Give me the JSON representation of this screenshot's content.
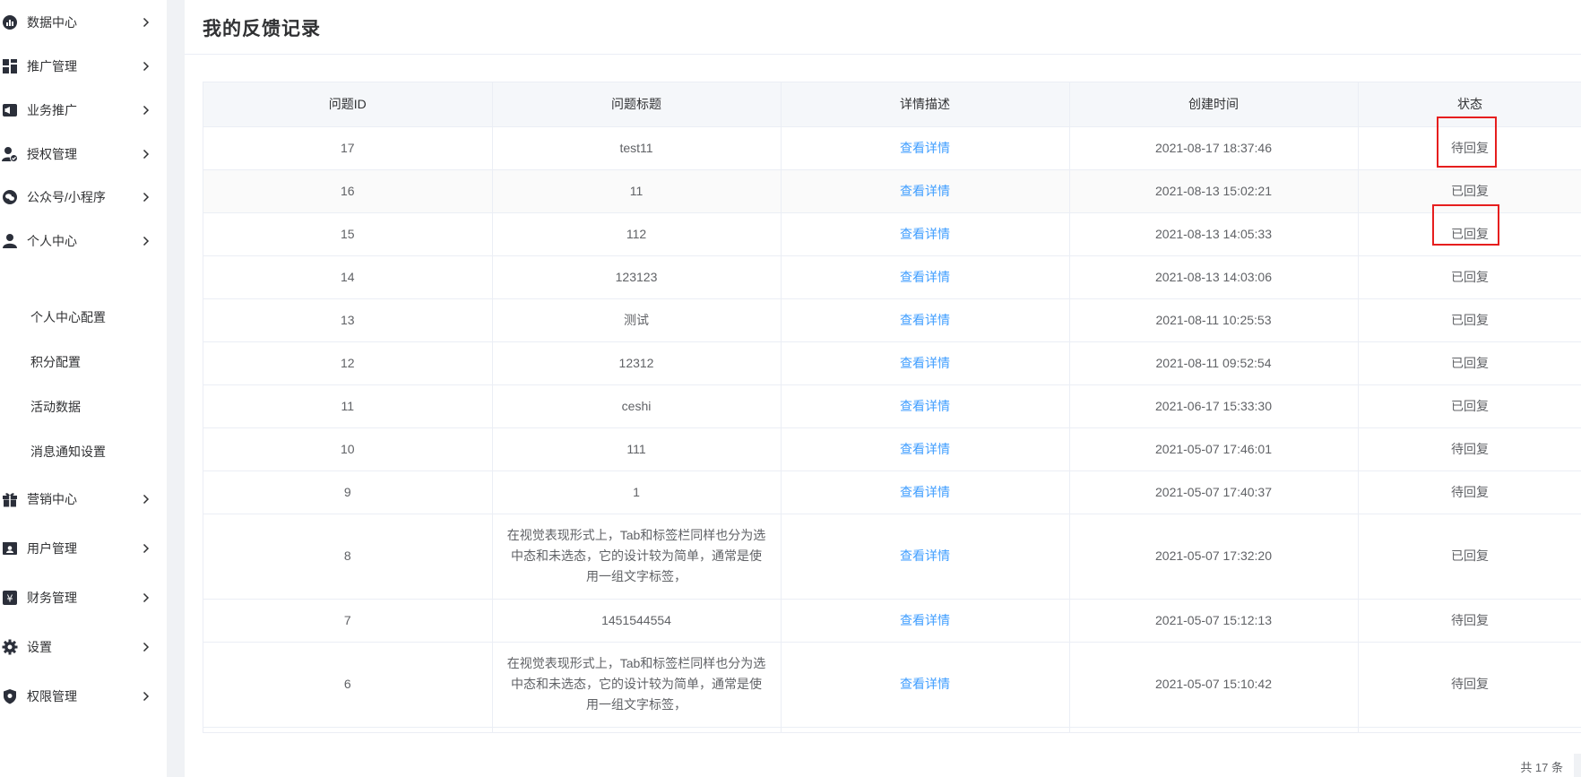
{
  "sidebar": {
    "items": [
      {
        "label": "数据中心",
        "icon": "chart-circle-icon"
      },
      {
        "label": "推广管理",
        "icon": "dashboard-grid-icon"
      },
      {
        "label": "业务推广",
        "icon": "megaphone-icon"
      },
      {
        "label": "授权管理",
        "icon": "user-check-icon"
      },
      {
        "label": "公众号/小程序",
        "icon": "wechat-icon"
      },
      {
        "label": "个人中心",
        "icon": "user-icon"
      },
      {
        "label": "营销中心",
        "icon": "gift-icon"
      },
      {
        "label": "用户管理",
        "icon": "id-card-icon"
      },
      {
        "label": "财务管理",
        "icon": "yen-icon"
      },
      {
        "label": "设置",
        "icon": "gear-icon"
      },
      {
        "label": "权限管理",
        "icon": "shield-icon"
      }
    ],
    "sub_items": [
      "个人中心配置",
      "积分配置",
      "活动数据",
      "消息通知设置"
    ]
  },
  "page": {
    "title": "我的反馈记录"
  },
  "table": {
    "headers": [
      "问题ID",
      "问题标题",
      "详情描述",
      "创建时间",
      "状态"
    ],
    "rows": [
      {
        "id": "17",
        "title": "test11",
        "detail": "查看详情",
        "time": "2021-08-17 18:37:46",
        "status": "待回复"
      },
      {
        "id": "16",
        "title": "11",
        "detail": "查看详情",
        "time": "2021-08-13 15:02:21",
        "status": "已回复"
      },
      {
        "id": "15",
        "title": "112",
        "detail": "查看详情",
        "time": "2021-08-13 14:05:33",
        "status": "已回复"
      },
      {
        "id": "14",
        "title": "123123",
        "detail": "查看详情",
        "time": "2021-08-13 14:03:06",
        "status": "已回复"
      },
      {
        "id": "13",
        "title": "测试",
        "detail": "查看详情",
        "time": "2021-08-11 10:25:53",
        "status": "已回复"
      },
      {
        "id": "12",
        "title": "12312",
        "detail": "查看详情",
        "time": "2021-08-11 09:52:54",
        "status": "已回复"
      },
      {
        "id": "11",
        "title": "ceshi",
        "detail": "查看详情",
        "time": "2021-06-17 15:33:30",
        "status": "已回复"
      },
      {
        "id": "10",
        "title": "111",
        "detail": "查看详情",
        "time": "2021-05-07 17:46:01",
        "status": "待回复"
      },
      {
        "id": "9",
        "title": "1",
        "detail": "查看详情",
        "time": "2021-05-07 17:40:37",
        "status": "待回复"
      },
      {
        "id": "8",
        "title": "在视觉表现形式上，Tab和标签栏同样也分为选中态和未选态，它的设计较为简单，通常是使用一组文字标签，",
        "detail": "查看详情",
        "time": "2021-05-07 17:32:20",
        "status": "已回复"
      },
      {
        "id": "7",
        "title": "1451544554",
        "detail": "查看详情",
        "time": "2021-05-07 15:12:13",
        "status": "待回复"
      },
      {
        "id": "6",
        "title": "在视觉表现形式上，Tab和标签栏同样也分为选中态和未选态，它的设计较为简单，通常是使用一组文字标签，",
        "detail": "查看详情",
        "time": "2021-05-07 15:10:42",
        "status": "待回复"
      }
    ]
  },
  "pagination": {
    "total_text": "共 17 条"
  },
  "colors": {
    "link": "#409eff",
    "highlight_box": "#e61e1e",
    "header_bg": "#f5f7fa"
  }
}
